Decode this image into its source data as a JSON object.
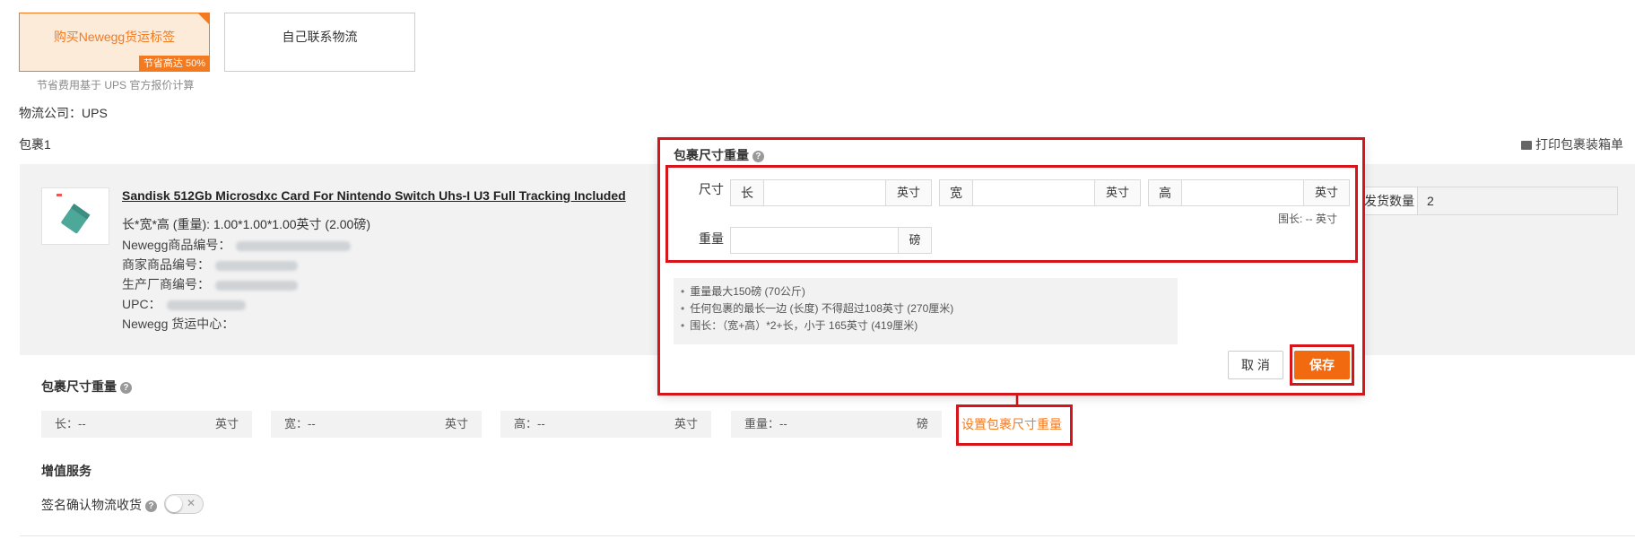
{
  "shipping_options": {
    "buy_label": "购买Newegg货运标签",
    "save_badge": "节省高达 50%",
    "self_contact": "自己联系物流",
    "note": "节省费用基于 UPS 官方报价计算"
  },
  "carrier": {
    "label": "物流公司：",
    "value": "UPS"
  },
  "package": {
    "title": "包裹1",
    "print_label": "打印包裹装箱单"
  },
  "item": {
    "title": "Sandisk 512Gb Microsdxc Card For Nintendo Switch Uhs-I U3 Full Tracking Included",
    "dims": "长*宽*高 (重量): 1.00*1.00*1.00英寸 (2.00磅)",
    "newegg_item_label": "Newegg商品编号：",
    "seller_item_label": "商家商品编号：",
    "mfr_label": "生产厂商编号：",
    "upc_label": "UPC：",
    "center_label": "Newegg 货运中心："
  },
  "ship_qty": {
    "label": "发货数量",
    "value": "2"
  },
  "package_dims": {
    "title": "包裹尺寸重量",
    "length_label": "长：--",
    "width_label": "宽：--",
    "height_label": "高：--",
    "weight_label": "重量：--",
    "unit_inch": "英寸",
    "unit_lb": "磅",
    "set_link": "设置包裹尺寸重量"
  },
  "value_added": {
    "title": "增值服务",
    "signature_label": "签名确认物流收货"
  },
  "popup": {
    "title": "包裹尺寸重量",
    "size_label": "尺寸",
    "weight_label": "重量",
    "length_prefix": "长",
    "width_prefix": "宽",
    "height_prefix": "高",
    "unit_inch": "英寸",
    "unit_lb": "磅",
    "girth": "围长: -- 英寸",
    "rules": [
      "重量最大150磅 (70公斤)",
      "任何包裹的最长一边 (长度) 不得超过108英寸 (270厘米)",
      "围长：（宽+高）*2+长，小于 165英寸 (419厘米)"
    ],
    "cancel": "取 消",
    "save": "保存"
  },
  "colors": {
    "accent": "#f47a20",
    "annotation": "#d7141a"
  }
}
